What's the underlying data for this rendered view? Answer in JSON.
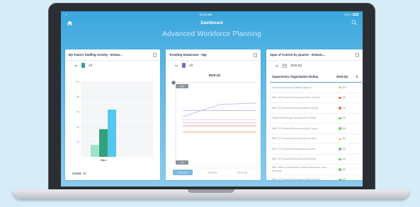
{
  "status_bar": {
    "carrier": "••",
    "time": "10:10 AM",
    "battery": "100%"
  },
  "nav": {
    "title": "Dashboard",
    "home_icon": "home-icon",
    "search_icon": "search-icon"
  },
  "page_title": "Advanced Workforce Planning",
  "cards": {
    "staffing": {
      "title": "My Team's Staffing Activity - Enhan...",
      "filter": "All",
      "filter_color": "#2aa198",
      "count_label": "Count",
      "count_value": "33",
      "chart_data": {
        "type": "bar",
        "categories": [
          "Hire"
        ],
        "series": [
          {
            "color": "#9ee3c8",
            "values": [
              16
            ]
          },
          {
            "color": "#35a17a",
            "values": [
              37
            ]
          },
          {
            "color": "#55c7ef",
            "values": [
              63
            ]
          }
        ],
        "yticks": [
          "100",
          "80",
          "60",
          "40",
          "20"
        ],
        "ylim": [
          0,
          100
        ]
      }
    },
    "headcount": {
      "title": "Trending Headcount - Hgr",
      "filter": "All",
      "filter_color": "#7b68c8",
      "period": "2015-Q1",
      "slider_value": "120",
      "slider_low": "70",
      "x_labels": [
        "2015-Q1",
        "2015-Q2",
        "2015-Q3"
      ],
      "chart_data": {
        "type": "line",
        "x": [
          "2015-Q1",
          "2015-Q2",
          "2015-Q3"
        ],
        "series": [
          {
            "color": "#c9b6e8",
            "values": [
              100,
              108,
              109
            ]
          },
          {
            "color": "#f4b3c2",
            "values": [
              96,
              96,
              96
            ]
          },
          {
            "color": "#f28b95",
            "values": [
              94,
              94,
              94
            ]
          },
          {
            "color": "#f6a35b",
            "values": [
              90,
              90,
              90
            ]
          },
          {
            "color": "#e6d0f0",
            "values": [
              98,
              98,
              98
            ]
          },
          {
            "color": "#b9b1e6",
            "values": [
              104,
              104,
              104
            ]
          }
        ],
        "ylim": [
          70,
          120
        ]
      }
    },
    "span": {
      "title": "Span of Control by Quarter - Enhanc...",
      "filter": "2015-Q1",
      "columns": [
        "Supervisory Organization Rollup",
        "2015-Q1",
        "2"
      ],
      "rows": [
        {
          "name": "Human Resources (Global Support)",
          "value": "6.0",
          "status": "warning"
        },
        {
          "name": "IBM CIO Human Resources (Chris LaFleur)",
          "value": "3.0",
          "status": "bad"
        },
        {
          "name": "IBM CIO Human Resources (Bob Perling)",
          "value": "7.0",
          "status": "bad"
        },
        {
          "name": "Global Technology Services (Jen Dolan)",
          "value": "4.0",
          "status": "good"
        },
        {
          "name": "IBM CIO Human Resources (Judy Lopez)",
          "value": "5.0",
          "status": "good"
        },
        {
          "name": "IBM CIO Human Resources (Jin Ah Kim)",
          "value": "4.0",
          "status": "warning"
        },
        {
          "name": "IBM CIO Human Resources (Lisa Kent)",
          "value": "4.0",
          "status": "good"
        },
        {
          "name": "IBM CIO Human Resources (Kirk Schill)",
          "value": "4.0",
          "status": "good"
        },
        {
          "name": "IBM Talent & Distribution Human Resources (Tom Fleming)",
          "value": "6.0",
          "status": "good"
        },
        {
          "name": "IBM CIO Human Resources (Hayley Evans)",
          "value": "6.0",
          "status": "good"
        }
      ],
      "status_colors": {
        "good": "#7bc86c",
        "warning": "#f0a92e",
        "bad": "#e8705a"
      }
    }
  }
}
